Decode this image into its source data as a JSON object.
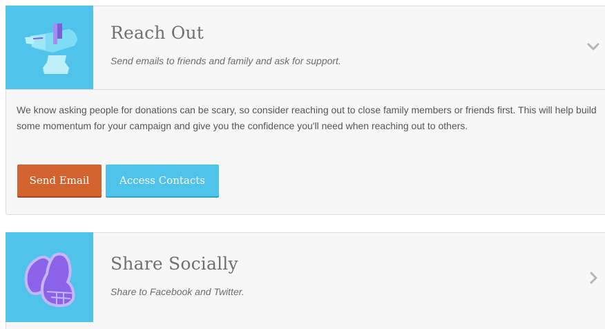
{
  "reach_out": {
    "title": "Reach Out",
    "subtitle": "Send emails to friends and family and ask for support.",
    "body": "We know asking people for donations can be scary, so consider reaching out to close family members or friends first. This will help build some momentum for your campaign and give you the confidence you'll need when reaching out to others.",
    "send_email_label": "Send Email",
    "access_contacts_label": "Access Contacts",
    "icon": "mailbox-icon",
    "expand_icon": "chevron-down-icon"
  },
  "share_socially": {
    "title": "Share Socially",
    "subtitle": "Share to Facebook and Twitter.",
    "icon": "butterfly-icon",
    "expand_icon": "chevron-right-icon"
  },
  "colors": {
    "thumb_bg": "#4fc3ea",
    "send_email_bg": "#d2622e",
    "access_contacts_bg": "#4fc3ea",
    "card_bg": "#f7f7f7"
  }
}
